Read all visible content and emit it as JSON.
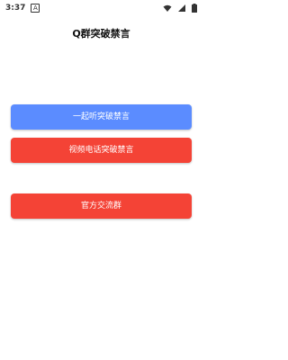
{
  "status_bar": {
    "time": "3:37",
    "notification_icon": "A",
    "icons": [
      "notification-a-icon",
      "wifi-icon",
      "signal-icon",
      "battery-icon"
    ]
  },
  "header": {
    "title": "Q群突破禁言"
  },
  "actions": {
    "listen_label": "一起听突破禁言",
    "video_label": "视频电话突破禁言",
    "official_group_label": "官方交流群"
  },
  "colors": {
    "primary_blue": "#5b8cff",
    "primary_red": "#f44336"
  }
}
